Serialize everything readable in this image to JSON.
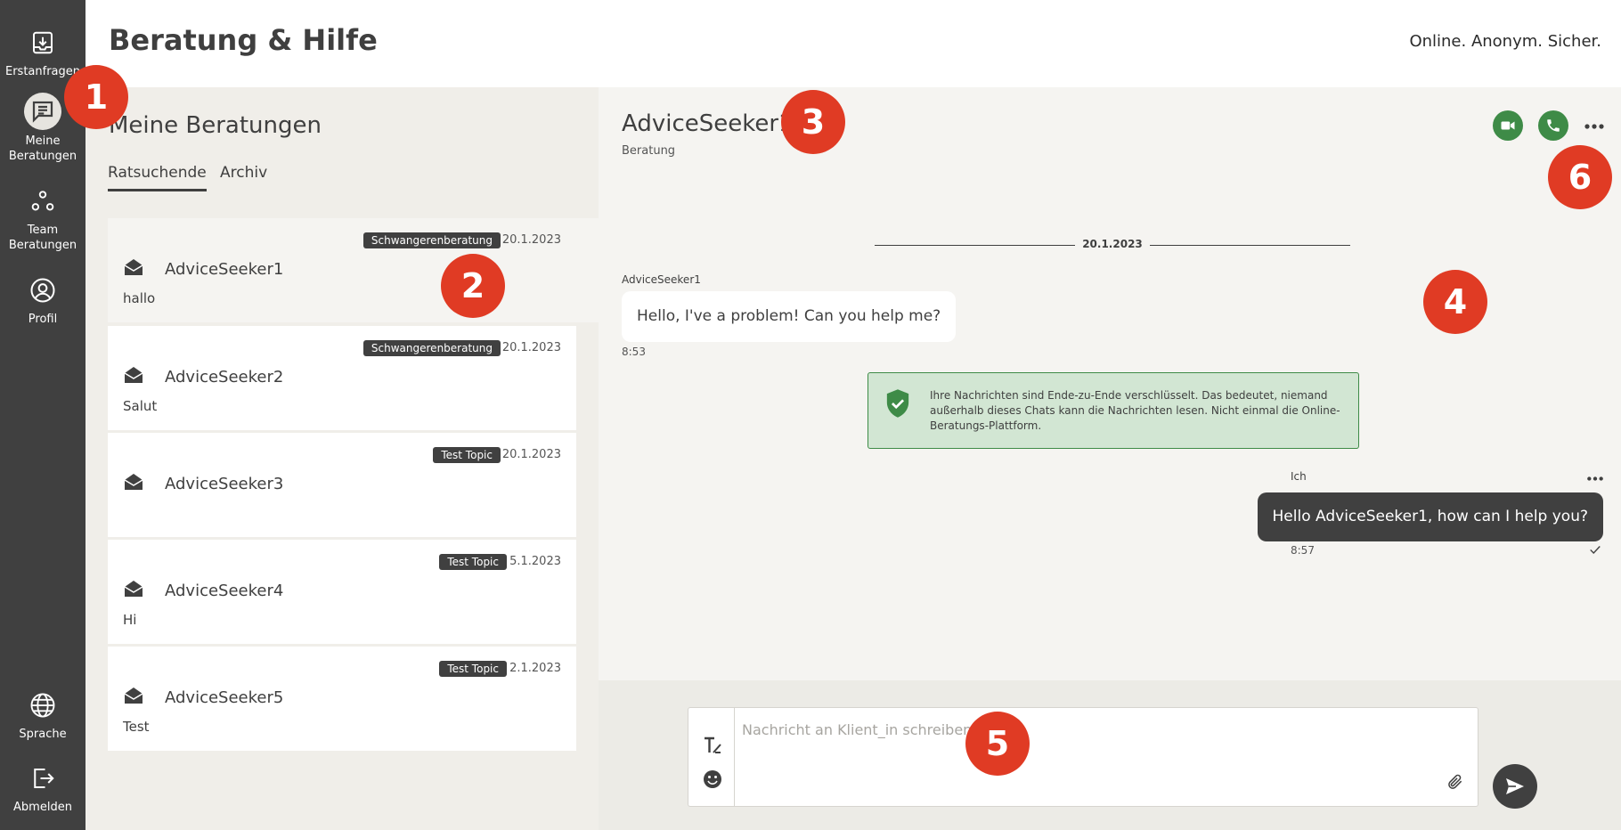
{
  "sidebar": {
    "items": [
      {
        "label": "Erstanfragen",
        "icon": "inbox-download-icon"
      },
      {
        "label": "Meine\nBeratungen",
        "icon": "chat-message-icon"
      },
      {
        "label": "Team\nBeratungen",
        "icon": "team-icon"
      },
      {
        "label": "Profil",
        "icon": "profile-icon"
      }
    ],
    "bottom_items": [
      {
        "label": "Sprache",
        "icon": "globe-icon"
      },
      {
        "label": "Abmelden",
        "icon": "logout-icon"
      }
    ]
  },
  "header": {
    "title": "Beratung & Hilfe",
    "tagline": "Online. Anonym. Sicher."
  },
  "sessions": {
    "title": "Meine Beratungen",
    "tabs": [
      {
        "label": "Ratsuchende",
        "active": true
      },
      {
        "label": "Archiv",
        "active": false
      }
    ],
    "items": [
      {
        "name": "AdviceSeeker1",
        "tag": "Schwangerenberatung",
        "date": "20.1.2023",
        "snippet": "hallo",
        "selected": true
      },
      {
        "name": "AdviceSeeker2",
        "tag": "Schwangerenberatung",
        "date": "20.1.2023",
        "snippet": "Salut",
        "selected": false
      },
      {
        "name": "AdviceSeeker3",
        "tag": "Test Topic",
        "date": "20.1.2023",
        "snippet": "",
        "selected": false
      },
      {
        "name": "AdviceSeeker4",
        "tag": "Test Topic",
        "date": "5.1.2023",
        "snippet": "Hi",
        "selected": false
      },
      {
        "name": "AdviceSeeker5",
        "tag": "Test Topic",
        "date": "2.1.2023",
        "snippet": "Test",
        "selected": false
      }
    ]
  },
  "chat": {
    "name": "AdviceSeeker1",
    "subtitle": "Beratung",
    "date_divider": "20.1.2023",
    "messages": [
      {
        "sender": "AdviceSeeker1",
        "text": "Hello, I've a problem! Can you help me?",
        "time": "8:53",
        "own": false
      },
      {
        "sender": "Ich",
        "text": "Hello AdviceSeeker1, how can I help you?",
        "time": "8:57",
        "own": true
      }
    ],
    "encryption_notice": "Ihre Nachrichten sind Ende-zu-Ende verschlüsselt. Das bedeutet, niemand außerhalb dieses Chats kann die Nachrichten lesen. Nicht einmal die Online-Beratungs-Plattform."
  },
  "composer": {
    "placeholder": "Nachricht an Klient_in schreiben",
    "value": ""
  },
  "markers": [
    "1",
    "2",
    "3",
    "4",
    "5",
    "6"
  ],
  "colors": {
    "sidebar": "#404040",
    "accent_green": "#3e8b47",
    "marker_red": "#e03b24",
    "notice_bg": "#d2e6d3"
  }
}
